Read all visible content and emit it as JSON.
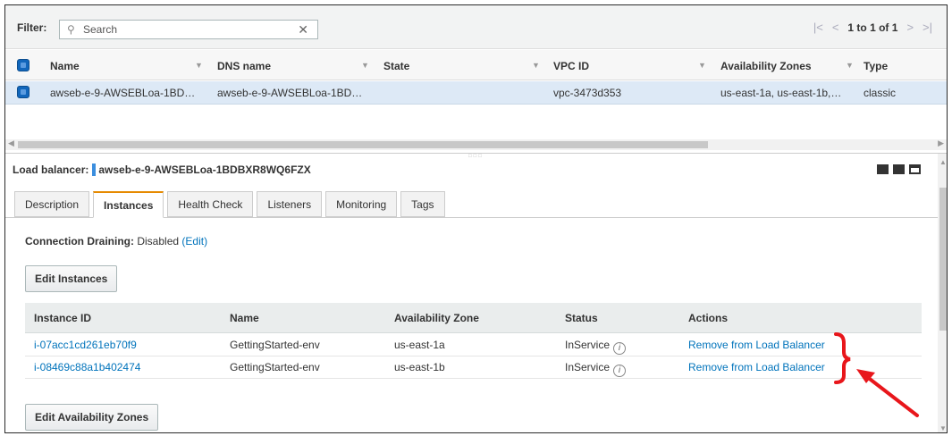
{
  "filter": {
    "label": "Filter:",
    "search_placeholder": "Search",
    "clear_icon": "close-icon"
  },
  "pager": {
    "first": "|<",
    "prev": "<",
    "text": "1 to 1 of 1",
    "next": ">",
    "last": ">|"
  },
  "table": {
    "columns": [
      "Name",
      "DNS name",
      "State",
      "VPC ID",
      "Availability Zones",
      "Type"
    ],
    "rows": [
      {
        "name": "awseb-e-9-AWSEBLoa-1BD…",
        "dns": "awseb-e-9-AWSEBLoa-1BD…",
        "state": "",
        "vpc": "vpc-3473d353",
        "zones": "us-east-1a, us-east-1b,…",
        "type": "classic"
      }
    ]
  },
  "detail": {
    "title_label": "Load balancer:",
    "title_value": "awseb-e-9-AWSEBLoa-1BDBXR8WQ6FZX",
    "tabs": [
      "Description",
      "Instances",
      "Health Check",
      "Listeners",
      "Monitoring",
      "Tags"
    ],
    "active_tab": "Instances",
    "draining_label": "Connection Draining:",
    "draining_value": "Disabled",
    "draining_edit": "(Edit)",
    "edit_instances": "Edit Instances",
    "edit_zones": "Edit Availability Zones"
  },
  "instances": {
    "columns": [
      "Instance ID",
      "Name",
      "Availability Zone",
      "Status",
      "Actions"
    ],
    "rows": [
      {
        "id": "i-07acc1cd261eb70f9",
        "name": "GettingStarted-env",
        "zone": "us-east-1a",
        "status": "InService",
        "action": "Remove from Load Balancer"
      },
      {
        "id": "i-08469c88a1b402474",
        "name": "GettingStarted-env",
        "zone": "us-east-1b",
        "status": "InService",
        "action": "Remove from Load Balancer"
      }
    ]
  },
  "colors": {
    "accent": "#0073bb",
    "selected_row": "#dde9f6",
    "active_tab": "#e68a00",
    "annotation": "#e8161b"
  }
}
